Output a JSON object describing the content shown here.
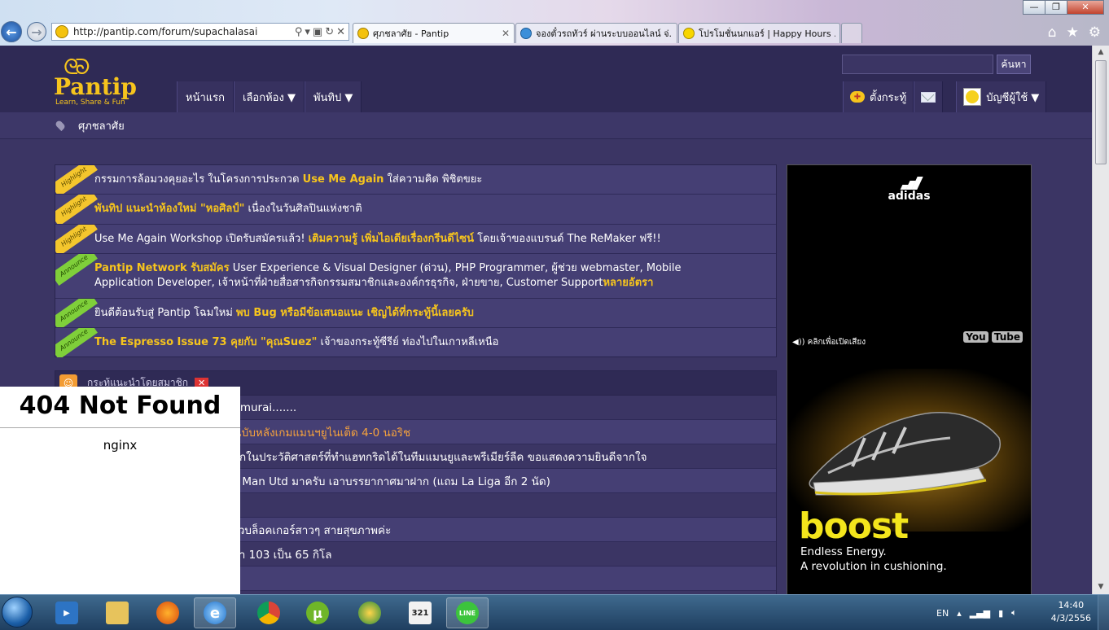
{
  "window": {
    "minimize": "—",
    "maximize": "❐",
    "close": "✕"
  },
  "browser": {
    "url": "http://pantip.com/forum/supachalasai",
    "tabs": [
      {
        "label": "ศุภชลาศัย - Pantip",
        "active": true
      },
      {
        "label": "จองตั๋วรถทัวร์ ผ่านระบบออนไลน์ จ่...",
        "active": false
      },
      {
        "label": "โปรโมชั่นนกแอร์ | Happy Hours ...",
        "active": false
      }
    ],
    "tab_close": "✕",
    "tools": [
      "⚲",
      "▾",
      "▣",
      "↻",
      "✕"
    ],
    "right_tools": [
      "⌂",
      "★",
      "⚙"
    ],
    "back": "←",
    "forward": "→"
  },
  "site": {
    "logo_mark": "ᘓᘐ",
    "logo_name": "Pantip",
    "logo_tagline": "Learn, Share & Fun",
    "search_button": "ค้นหา",
    "nav": [
      "หน้าแรก",
      "เลือกห้อง ▼",
      "พันทิป ▼"
    ],
    "user_nav": {
      "post": "ตั้งกระทู้",
      "account": "บัญชีผู้ใช้ ▼"
    },
    "breadcrumb": "ศุภชลาศัย"
  },
  "announcements": [
    {
      "tag": "Highlight",
      "kind": "hl",
      "parts": [
        "กรรมการล้อมวงคุยอะไร ในโครงการประกวด ",
        "Use Me Again",
        " ใส่ความคิด พิชิตขยะ"
      ]
    },
    {
      "tag": "Highlight",
      "kind": "hl",
      "parts": [
        "",
        "พันทิป แนะนำห้องใหม่ \"หอศิลป์\"",
        " เนื่องในวันศิลปินแห่งชาติ"
      ]
    },
    {
      "tag": "Highlight",
      "kind": "hl",
      "parts": [
        "Use Me Again Workshop เปิดรับสมัครแล้ว! ",
        "เติมความรู้ เพิ่มไอเดียเรื่องกรีนดีไซน์",
        " โดยเจ้าของแบรนด์ The ReMaker ฟรี!!"
      ]
    },
    {
      "tag": "Announce",
      "kind": "an",
      "parts": [
        "",
        "Pantip Network รับสมัคร",
        " User Experience & Visual Designer (ด่วน), PHP Programmer, ผู้ช่วย webmaster, Mobile Application Developer, เจ้าหน้าที่ฝ่ายสื่อสารกิจกรรมสมาชิกและองค์กรธุรกิจ, ฝ่ายขาย, Customer Support"
      ],
      "suffix": "หลายอัตรา"
    },
    {
      "tag": "Announce",
      "kind": "an",
      "parts": [
        "ยินดีต้อนรับสู่ Pantip โฉมใหม่ ",
        "พบ Bug หรือมีข้อเสนอแนะ เชิญได้ที่กระทู้นี้เลยครับ",
        ""
      ]
    },
    {
      "tag": "Announce",
      "kind": "an",
      "parts": [
        "",
        "The Espresso Issue 73 คุยกับ \"คุณSuez\"",
        " เจ้าของกระทู้ซีรีย์ ท่องไปในเกาหลีเหนือ"
      ]
    }
  ],
  "recommended": {
    "title": "กระทู้แนะนำโดยสมาชิก",
    "close": "✕",
    "rows": [
      {
        "text": "Samurai.......",
        "orange": false
      },
      {
        "text": ") ฉบับหลังเกมแมนฯยูไนเต็ด 4-0 นอริช",
        "orange": true
      },
      {
        "text": "แรกในประวัติศาสตร์ที่ทำแฮทกริดได้ในทีมแมนยูและพรีเมียร์ลีค ขอแสดงความยินดีจากใจ",
        "orange": false
      },
      {
        "text": "vs Man Utd มาครับ เอาบรรยากาศมาฝาก (แถม La Liga อีก 2 นัด)",
        "orange": false
      },
      {
        "text": "",
        "orange": false
      },
      {
        "text": "รีวิวบล็อคเกอร์สาวๆ สายสุขภาพค่ะ",
        "orange": false
      },
      {
        "text": "ากา 103 เป็น 65 กิโล",
        "orange": false
      },
      {
        "text": "",
        "orange": false
      }
    ]
  },
  "error_overlay": {
    "title": "404 Not Found",
    "server": "nginx"
  },
  "ad": {
    "brand": "adidas",
    "sound": "◀)) คลิกเพื่อเปิดเสียง",
    "youtube_a": "You",
    "youtube_b": "Tube",
    "headline": "boost",
    "line1": "Endless Energy.",
    "line2": "A revolution in cushioning."
  },
  "taskbar": {
    "language": "EN",
    "time": "14:40",
    "date": "4/3/2556",
    "apps": [
      "media",
      "explorer",
      "firefox",
      "ie",
      "chrome",
      "utorrent",
      "network",
      "calendar",
      "line"
    ],
    "app_labels": {
      "calendar": "321",
      "line": "LINE",
      "utorrent": "µ"
    }
  },
  "colors": {
    "accent": "#f6c41d",
    "page_bg": "#3b3564",
    "highlight_tag": "#f4c62d",
    "announce_tag": "#7fcf3a"
  }
}
